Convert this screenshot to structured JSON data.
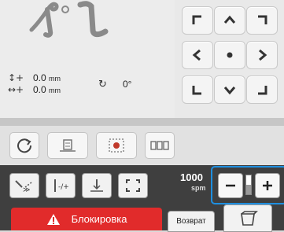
{
  "preview": {
    "motif_icon": "embroidery-preview-icon",
    "readouts": {
      "height_icon": "height-arrow-icon",
      "height_value": "0.0",
      "height_unit": "mm",
      "width_icon": "width-arrow-icon",
      "width_value": "0.0",
      "width_unit": "mm",
      "rotation_icon": "rotate-icon",
      "rotation_value": "0°"
    }
  },
  "navigation": {
    "buttons": [
      "move-top-left",
      "move-up",
      "move-top-right",
      "move-left",
      "move-center",
      "move-right",
      "move-bottom-left",
      "move-down",
      "move-bottom-right"
    ]
  },
  "edit_tools": [
    "rotate",
    "trim",
    "basting",
    "layout"
  ],
  "tool_band": {
    "buttons": [
      "stitch-skip",
      "needle-position",
      "thread-tension",
      "frame-check"
    ],
    "speed": {
      "value": "1000",
      "unit": "spm",
      "level_fraction": 0.5,
      "minus_icon": "minus-icon",
      "plus_icon": "plus-icon"
    },
    "lock_label": "Блокировка",
    "return_label": "Возврат",
    "spool_icon": "bobbin-icon"
  },
  "colors": {
    "accent": "#1e8fe0",
    "lock_red": "#e12b2b",
    "dark_band": "#3f3f3f"
  }
}
